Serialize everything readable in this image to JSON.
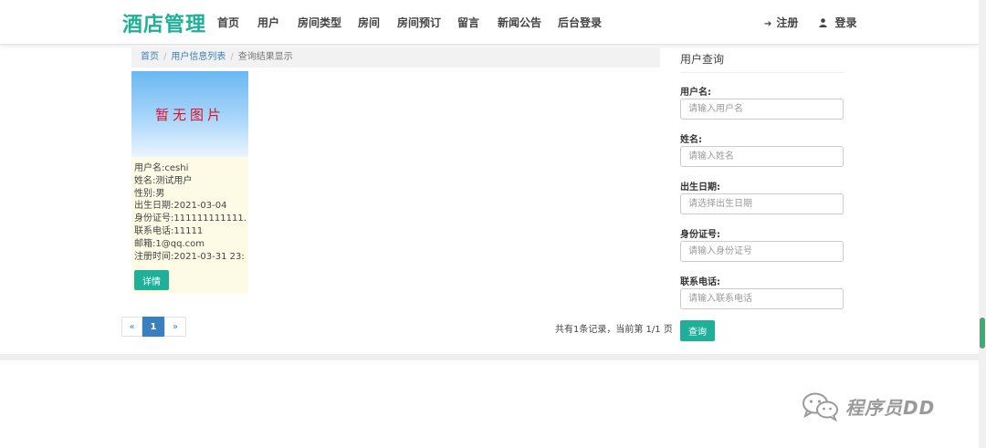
{
  "nav": {
    "brand": "酒店管理",
    "items": [
      "首页",
      "用户",
      "房间类型",
      "房间",
      "房间预订",
      "留言",
      "新闻公告",
      "后台登录"
    ],
    "register": "注册",
    "login": "登录"
  },
  "breadcrumb": {
    "home": "首页",
    "list": "用户信息列表",
    "current": "查询结果显示"
  },
  "card": {
    "placeholder_image_text": "暂无图片",
    "lines": [
      "用户名:ceshi",
      "姓名:测试用户",
      "性别:男",
      "出生日期:2021-03-04",
      "身份证号:111111111111...",
      "联系电话:11111",
      "邮箱:1@qq.com",
      "注册时间:2021-03-31 23:..."
    ],
    "detail_button": "详情"
  },
  "pagination": {
    "prev": "«",
    "current": "1",
    "next": "»",
    "summary": "共有1条记录，当前第 1/1 页"
  },
  "search_panel": {
    "title": "用户查询",
    "fields": [
      {
        "label": "用户名:",
        "placeholder": "请输入用户名"
      },
      {
        "label": "姓名:",
        "placeholder": "请输入姓名"
      },
      {
        "label": "出生日期:",
        "placeholder": "请选择出生日期"
      },
      {
        "label": "身份证号:",
        "placeholder": "请输入身份证号"
      },
      {
        "label": "联系电话:",
        "placeholder": "请输入联系电话"
      }
    ],
    "submit": "查询"
  },
  "watermark": "程序员DD",
  "colors": {
    "brand": "#1fb09a",
    "link": "#3a7fbf",
    "card_bg": "#fdfbe6",
    "placeholder_text": "#e0102c"
  }
}
